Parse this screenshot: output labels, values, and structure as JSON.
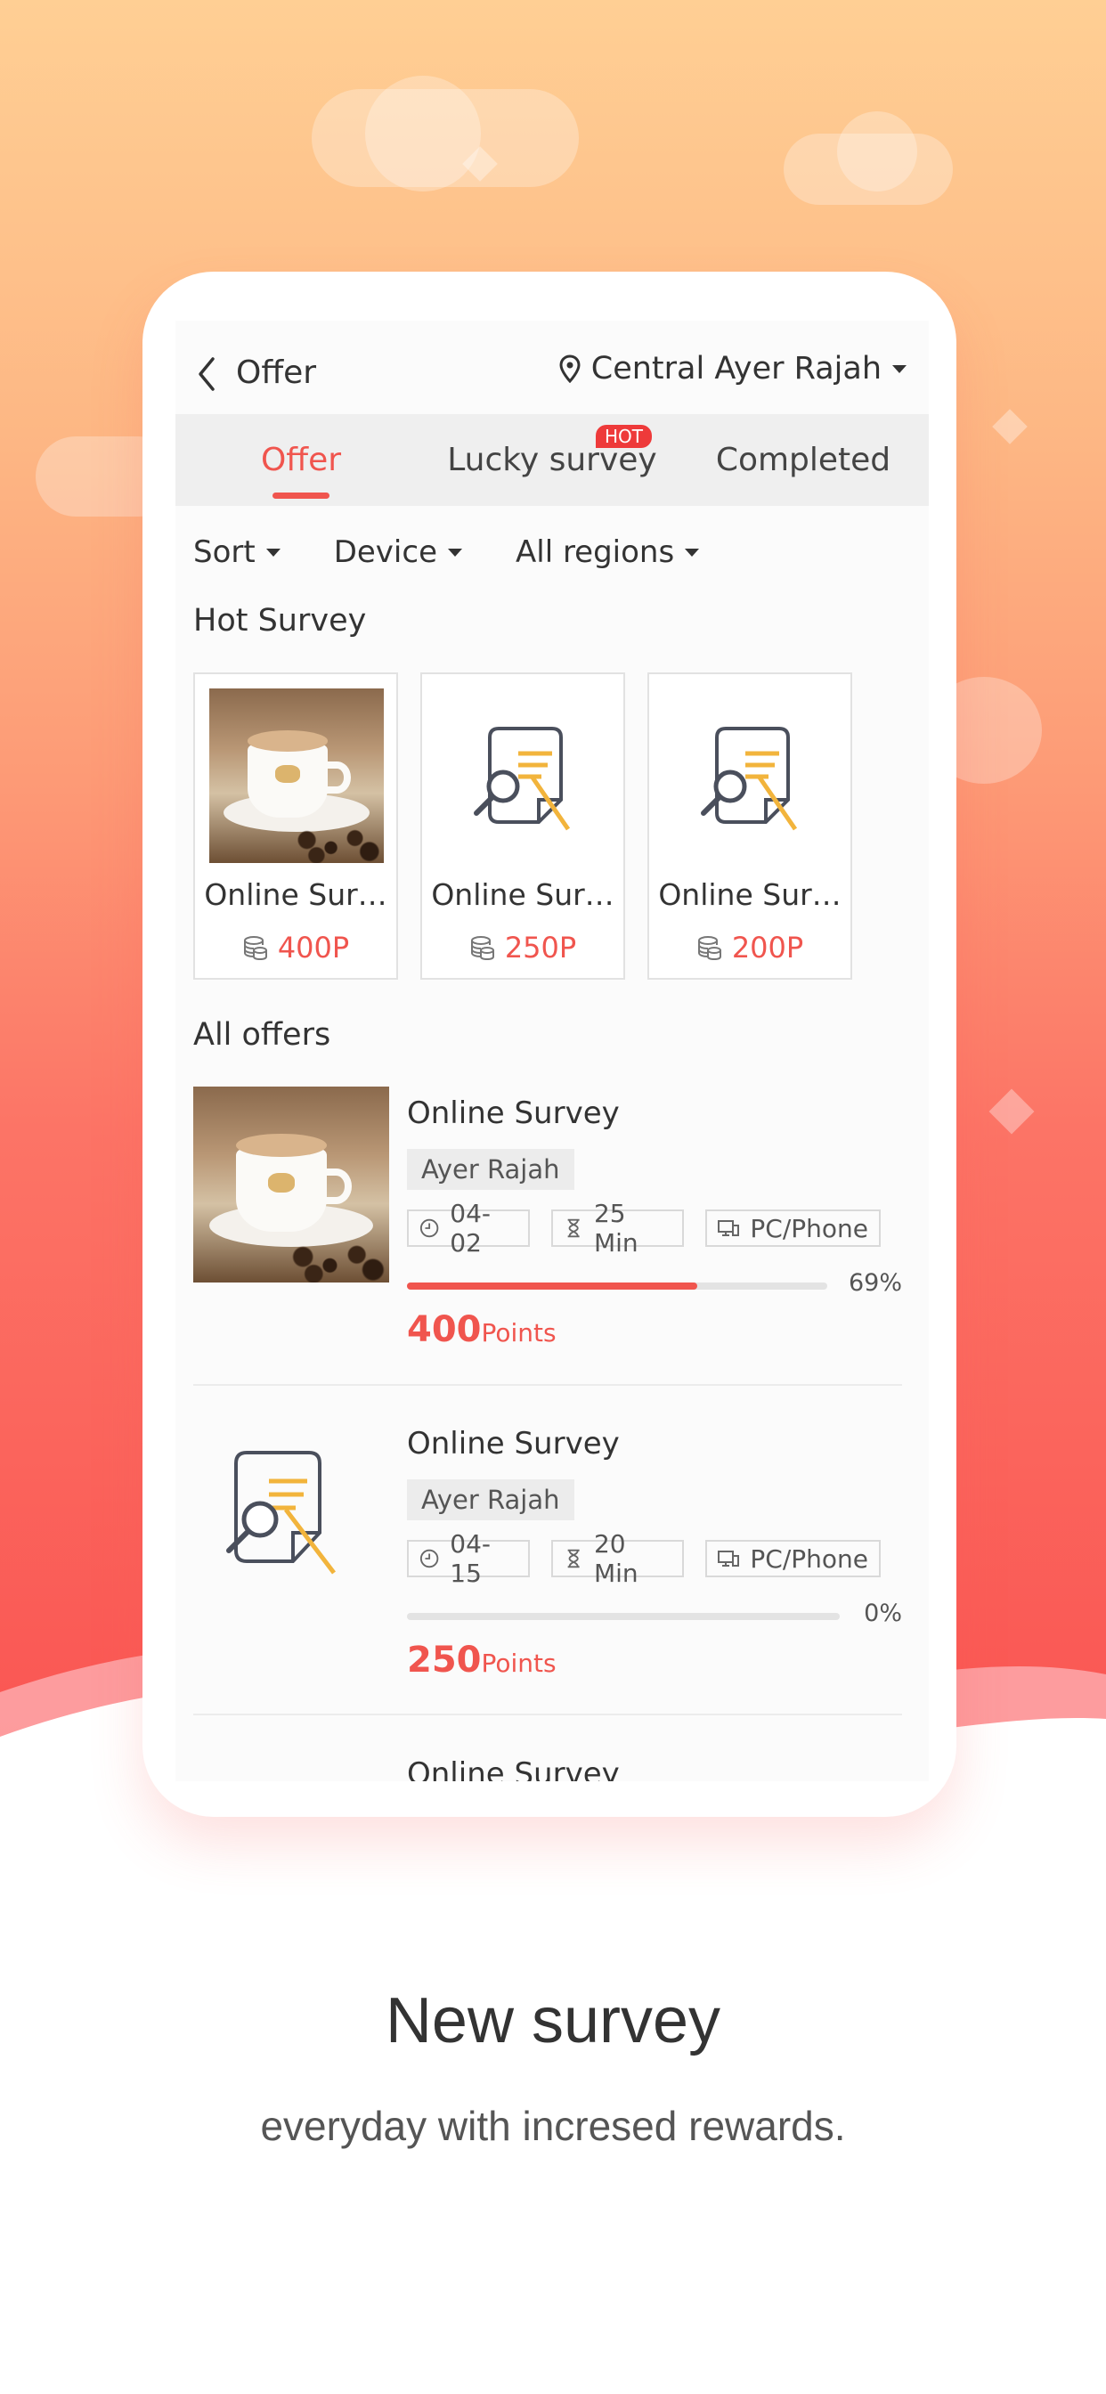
{
  "header": {
    "title": "Offer",
    "location": "Central Ayer Rajah"
  },
  "tabs": [
    {
      "label": "Offer",
      "active": true
    },
    {
      "label": "Lucky survey",
      "badge": "HOT"
    },
    {
      "label": "Completed"
    }
  ],
  "filters": [
    "Sort",
    "Device",
    "All regions"
  ],
  "hot_survey": {
    "title": "Hot Survey",
    "items": [
      {
        "name": "Online Sur…",
        "points": "400P",
        "image": "coffee-photo"
      },
      {
        "name": "Online Sur…",
        "points": "250P",
        "image": "survey-icon"
      },
      {
        "name": "Online Sur…",
        "points": "200P",
        "image": "survey-icon"
      }
    ]
  },
  "all_offers": {
    "title": "All offers",
    "items": [
      {
        "title": "Online Survey",
        "region": "Ayer Rajah",
        "date": "04-02",
        "duration": "25 Min",
        "device": "PC/Phone",
        "progress_pct": 69,
        "progress_label": "69%",
        "points": "400",
        "points_unit": "Points",
        "image": "coffee-photo"
      },
      {
        "title": "Online Survey",
        "region": "Ayer Rajah",
        "date": "04-15",
        "duration": "20 Min",
        "device": "PC/Phone",
        "progress_pct": 0,
        "progress_label": "0%",
        "points": "250",
        "points_unit": "Points",
        "image": "survey-icon"
      },
      {
        "title": "Online Survey"
      }
    ]
  },
  "caption": {
    "title": "New survey",
    "subtitle": "everyday with incresed rewards."
  },
  "colors": {
    "accent": "#f0554e",
    "survey_icon_yellow": "#f2b43c",
    "survey_icon_gray": "#4a4f5c"
  }
}
